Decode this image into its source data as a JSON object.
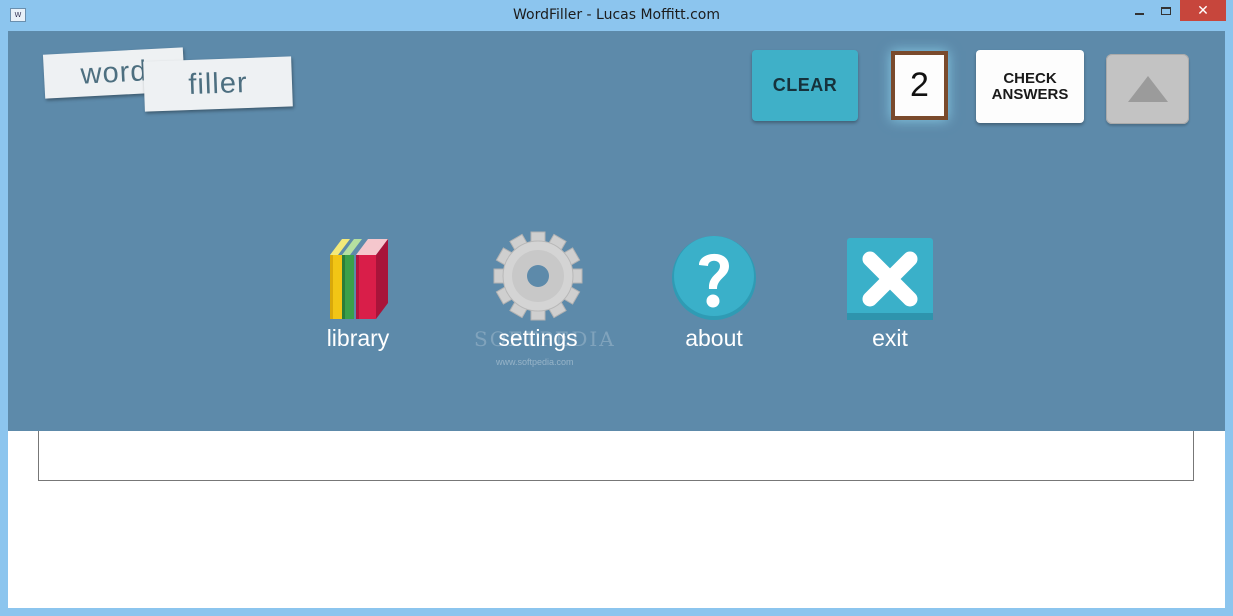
{
  "window": {
    "title": "WordFiller - Lucas Moffitt.com",
    "icon": "app-icon",
    "icon_text": "W"
  },
  "logo": {
    "word": "word",
    "filler": "filler"
  },
  "toolbar": {
    "clear_label": "CLEAR",
    "counter_value": "2",
    "check_label_line1": "CHECK",
    "check_label_line2": "ANSWERS",
    "up_icon": "triangle-up-icon"
  },
  "menu": {
    "items": [
      {
        "id": "library",
        "label": "library",
        "icon": "books-icon"
      },
      {
        "id": "settings",
        "label": "settings",
        "icon": "gear-icon"
      },
      {
        "id": "about",
        "label": "about",
        "icon": "question-icon"
      },
      {
        "id": "exit",
        "label": "exit",
        "icon": "close-x-icon"
      }
    ]
  },
  "watermark": {
    "text": "SOFTPEDIA",
    "url": "www.softpedia.com"
  },
  "colors": {
    "panel": "#5d8aaa",
    "titlebar": "#8cc5ee",
    "accent": "#3fb0c8",
    "close": "#c7463c"
  }
}
